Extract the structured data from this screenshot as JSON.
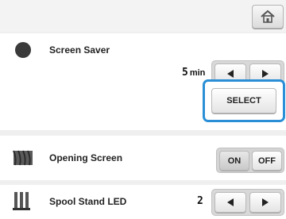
{
  "header": {
    "home_icon": "home-icon"
  },
  "settings": [
    {
      "label": "Screen Saver",
      "icon": "screen-saver-icon",
      "value": "5",
      "unit": "min",
      "decrease_icon": "left-arrow-icon",
      "increase_icon": "right-arrow-icon",
      "select_label": "SELECT"
    },
    {
      "label": "Opening Screen",
      "icon": "opening-screen-icon",
      "on_label": "ON",
      "off_label": "OFF",
      "selected": "ON"
    },
    {
      "label": "Spool Stand LED",
      "icon": "spool-stand-icon",
      "value": "2",
      "decrease_icon": "left-arrow-icon",
      "increase_icon": "right-arrow-icon"
    }
  ],
  "colors": {
    "highlight": "#2a8fd6",
    "background": "#efefef",
    "panel": "#ffffff"
  }
}
